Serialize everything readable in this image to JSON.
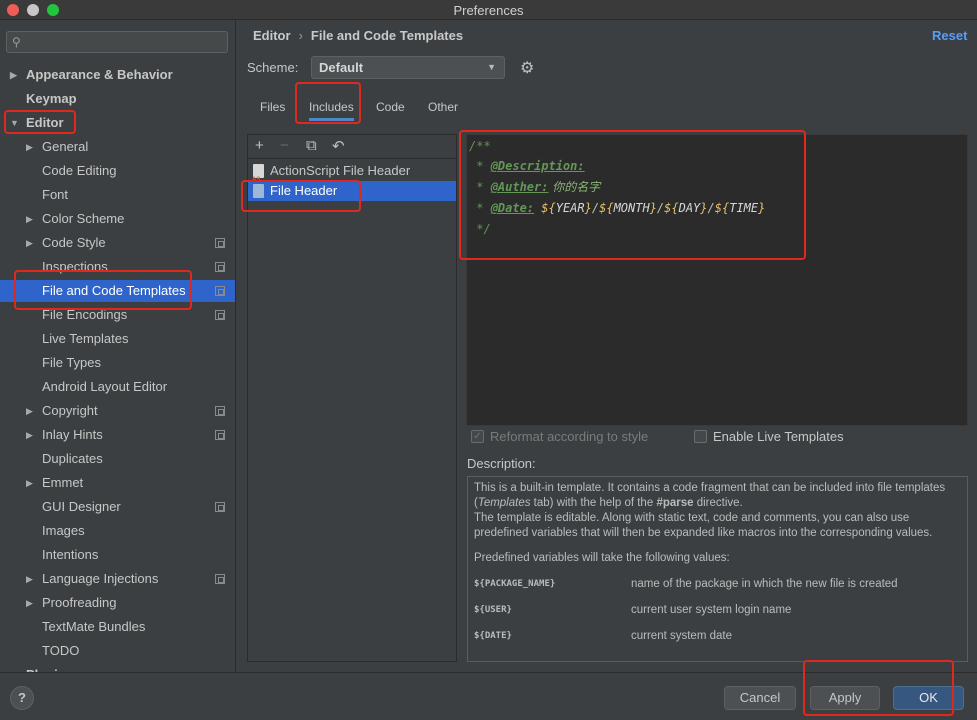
{
  "window": {
    "title": "Preferences"
  },
  "sidebar": {
    "search_placeholder": "",
    "items": [
      {
        "label": "Appearance & Behavior",
        "level": 0,
        "expandable": true,
        "expanded": false
      },
      {
        "label": "Keymap",
        "level": 0,
        "expandable": false
      },
      {
        "label": "Editor",
        "level": 0,
        "expandable": true,
        "expanded": true
      },
      {
        "label": "General",
        "level": 1,
        "expandable": true
      },
      {
        "label": "Code Editing",
        "level": 1
      },
      {
        "label": "Font",
        "level": 1
      },
      {
        "label": "Color Scheme",
        "level": 1,
        "expandable": true
      },
      {
        "label": "Code Style",
        "level": 1,
        "expandable": true,
        "project_icon": true
      },
      {
        "label": "Inspections",
        "level": 1,
        "project_icon": true
      },
      {
        "label": "File and Code Templates",
        "level": 1,
        "selected": true,
        "project_icon": true
      },
      {
        "label": "File Encodings",
        "level": 1,
        "project_icon": true
      },
      {
        "label": "Live Templates",
        "level": 1
      },
      {
        "label": "File Types",
        "level": 1
      },
      {
        "label": "Android Layout Editor",
        "level": 1
      },
      {
        "label": "Copyright",
        "level": 1,
        "expandable": true,
        "project_icon": true
      },
      {
        "label": "Inlay Hints",
        "level": 1,
        "expandable": true,
        "project_icon": true
      },
      {
        "label": "Duplicates",
        "level": 1
      },
      {
        "label": "Emmet",
        "level": 1,
        "expandable": true
      },
      {
        "label": "GUI Designer",
        "level": 1,
        "project_icon": true
      },
      {
        "label": "Images",
        "level": 1
      },
      {
        "label": "Intentions",
        "level": 1
      },
      {
        "label": "Language Injections",
        "level": 1,
        "expandable": true,
        "project_icon": true
      },
      {
        "label": "Proofreading",
        "level": 1,
        "expandable": true
      },
      {
        "label": "TextMate Bundles",
        "level": 1
      },
      {
        "label": "TODO",
        "level": 1
      },
      {
        "label": "Plugins",
        "level": 0
      }
    ]
  },
  "header": {
    "breadcrumb": [
      "Editor",
      "File and Code Templates"
    ],
    "breadcrumb_sep": "›",
    "reset_label": "Reset"
  },
  "scheme": {
    "label": "Scheme:",
    "value": "Default"
  },
  "tabs": [
    {
      "label": "Files"
    },
    {
      "label": "Includes",
      "active": true
    },
    {
      "label": "Code"
    },
    {
      "label": "Other"
    }
  ],
  "template_list": {
    "toolbar": [
      "+",
      "−",
      "⧉",
      "↶"
    ],
    "items": [
      {
        "label": "ActionScript File Header",
        "icon": "actionscript-file-icon"
      },
      {
        "label": "File Header",
        "icon": "java-file-icon",
        "selected": true
      }
    ]
  },
  "editor": {
    "line1": "/**",
    "line2_prefix": " * ",
    "line2_tag": "@Description:",
    "line3_prefix": " * ",
    "line3_tag": "@Auther:",
    "line3_value": " 你的名字",
    "line4_prefix": " * ",
    "line4_tag": "@Date:",
    "date_vars": [
      "YEAR",
      "MONTH",
      "DAY",
      "TIME"
    ],
    "line5": " */"
  },
  "options": {
    "reformat_label": "Reformat according to style",
    "reformat_checked": true,
    "live_templates_label": "Enable Live Templates",
    "live_templates_checked": false
  },
  "description": {
    "label": "Description:",
    "p1_a": "This is a built-in template. It contains a code fragment that can be included into file templates (",
    "p1_italic": "Templates",
    "p1_b": " tab) with the help of the ",
    "p1_bold": "#parse",
    "p1_c": " directive.",
    "p2": "The template is editable. Along with static text, code and comments, you can also use predefined variables that will then be expanded like macros into the corresponding values.",
    "p3": "Predefined variables will take the following values:",
    "vars": [
      {
        "key": "${PACKAGE_NAME}",
        "value": "name of the package in which the new file is created"
      },
      {
        "key": "${USER}",
        "value": "current user system login name"
      },
      {
        "key": "${DATE}",
        "value": "current system date"
      }
    ]
  },
  "footer": {
    "help": "?",
    "cancel": "Cancel",
    "apply": "Apply",
    "ok": "OK"
  },
  "colors": {
    "selection": "#2f65ca",
    "accent_link": "#589df6",
    "annotation_red": "#e0291e",
    "comment_green": "#629755",
    "template_var": "#e8bf6a"
  }
}
